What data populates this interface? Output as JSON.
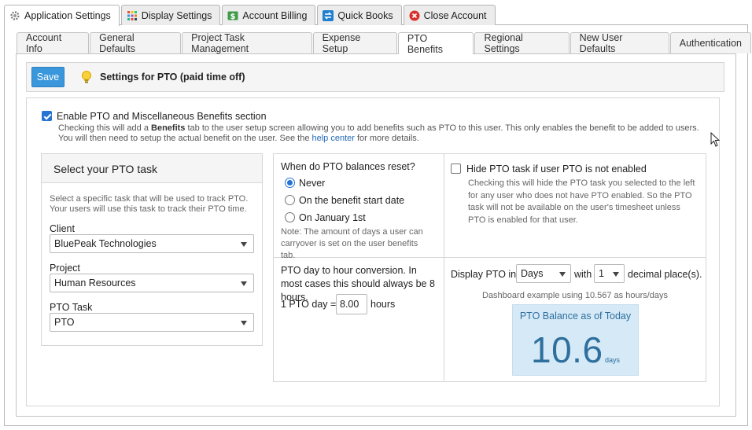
{
  "top_tabs": [
    {
      "label": "Application Settings",
      "icon": "gear-icon"
    },
    {
      "label": "Display Settings",
      "icon": "grid-icon"
    },
    {
      "label": "Account Billing",
      "icon": "billing-icon"
    },
    {
      "label": "Quick Books",
      "icon": "sync-icon"
    },
    {
      "label": "Close Account",
      "icon": "close-circle-icon"
    }
  ],
  "sub_tabs": [
    {
      "label": "Account Info"
    },
    {
      "label": "General Defaults"
    },
    {
      "label": "Project Task Management"
    },
    {
      "label": "Expense Setup"
    },
    {
      "label": "PTO Benefits"
    },
    {
      "label": "Regional Settings"
    },
    {
      "label": "New User Defaults"
    },
    {
      "label": "Authentication"
    }
  ],
  "header": {
    "save_label": "Save",
    "title": "Settings for PTO (paid time off)"
  },
  "enable": {
    "label": "Enable PTO and Miscellaneous Benefits section",
    "desc_part1": "Checking this will add a ",
    "desc_bold": "Benefits",
    "desc_part2": " tab to the user setup screen allowing you to add benefits such as PTO to this user. This only enables the benefit to be added to users. You will then need to setup the actual benefit on the user. See the ",
    "desc_link": "help center",
    "desc_part3": " for more details."
  },
  "select_task": {
    "title": "Select your PTO task",
    "desc": "Select a specific task that will be used to track PTO. Your users will use this task to track their PTO time.",
    "client_label": "Client",
    "client_value": "BluePeak Technologies",
    "project_label": "Project",
    "project_value": "Human Resources",
    "task_label": "PTO Task",
    "task_value": "PTO"
  },
  "reset": {
    "question": "When do PTO balances reset?",
    "options": [
      "Never",
      "On the benefit start date",
      "On January 1st"
    ],
    "note": "Note: The amount of days a user can carryover is set on the user benefits tab."
  },
  "hide_pto": {
    "label": "Hide PTO task if user PTO is not enabled",
    "desc": "Checking this will hide the PTO task you selected to the left for any user who does not have PTO enabled. So the PTO task will not be available on the user's timesheet unless PTO is enabled for that user."
  },
  "conversion": {
    "desc": "PTO day to hour conversion. In most cases this should always be 8 hours.",
    "prefix": "1 PTO day =",
    "value": "8.00",
    "suffix": "hours"
  },
  "display": {
    "prefix": "Display PTO in",
    "unit_value": "Days",
    "with": "with",
    "decimal_value": "1",
    "suffix": "decimal place(s).",
    "example": "Dashboard example using 10.567 as hours/days",
    "card_title": "PTO Balance as of Today",
    "card_value": "10.6",
    "card_unit": "days"
  }
}
